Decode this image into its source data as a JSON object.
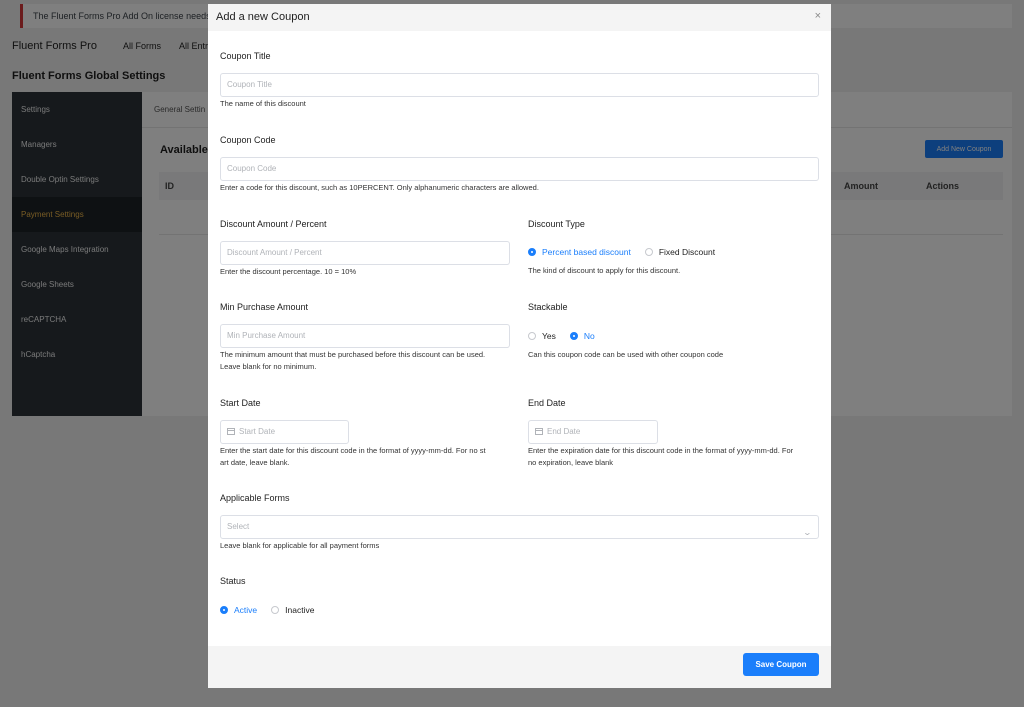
{
  "notice": {
    "text": "The Fluent Forms Pro Add On license needs to be"
  },
  "topnav": {
    "brand": "Fluent Forms Pro",
    "links": [
      "All Forms",
      "All Entries"
    ]
  },
  "page_title": "Fluent Forms Global Settings",
  "sidebar": {
    "items": [
      {
        "label": "Settings"
      },
      {
        "label": "Managers"
      },
      {
        "label": "Double Optin Settings"
      },
      {
        "label": "Payment Settings"
      },
      {
        "label": "Google Maps Integration"
      },
      {
        "label": "Google Sheets"
      },
      {
        "label": "reCAPTCHA"
      },
      {
        "label": "hCaptcha"
      }
    ],
    "active_index": 3
  },
  "content": {
    "tab": "General Settin",
    "heading": "Available C",
    "add_button": "Add New Coupon",
    "table_columns": {
      "id": "ID",
      "amount": "Amount",
      "actions": "Actions"
    }
  },
  "modal": {
    "title": "Add a new Coupon",
    "close_symbol": "×",
    "coupon_title": {
      "label": "Coupon Title",
      "placeholder": "Coupon Title",
      "help": "The name of this discount"
    },
    "coupon_code": {
      "label": "Coupon Code",
      "placeholder": "Coupon Code",
      "help": "Enter a code for this discount, such as 10PERCENT. Only alphanumeric characters are allowed."
    },
    "discount_amount": {
      "label": "Discount Amount / Percent",
      "placeholder": "Discount Amount / Percent",
      "help": "Enter the discount percentage. 10 = 10%"
    },
    "discount_type": {
      "label": "Discount Type",
      "options": [
        "Percent based discount",
        "Fixed Discount"
      ],
      "selected": "Percent based discount",
      "help": "The kind of discount to apply for this discount."
    },
    "min_purchase": {
      "label": "Min Purchase Amount",
      "placeholder": "Min Purchase Amount",
      "help_line1": "The minimum amount that must be purchased before this discount can be used.",
      "help_line2": "Leave blank for no minimum."
    },
    "stackable": {
      "label": "Stackable",
      "options": [
        "Yes",
        "No"
      ],
      "selected": "No",
      "help": "Can this coupon code can be used with other coupon code"
    },
    "start_date": {
      "label": "Start Date",
      "placeholder": "Start Date",
      "help_line1": "Enter the start date for this discount code in the format of yyyy-mm-dd. For no st",
      "help_line2": "art date, leave blank."
    },
    "end_date": {
      "label": "End Date",
      "placeholder": "End Date",
      "help_line1": "Enter the expiration date for this discount code in the format of yyyy-mm-dd. For",
      "help_line2": "no expiration, leave blank"
    },
    "applicable_forms": {
      "label": "Applicable Forms",
      "placeholder": "Select",
      "help": "Leave blank for applicable for all payment forms"
    },
    "status": {
      "label": "Status",
      "options": [
        "Active",
        "Inactive"
      ],
      "selected": "Active"
    },
    "save_button": "Save Coupon"
  },
  "colors": {
    "primary": "#1a7efb",
    "sidebar_bg": "#2c3338",
    "sidebar_active_text": "#f0b849",
    "notice_border": "#d63638"
  }
}
